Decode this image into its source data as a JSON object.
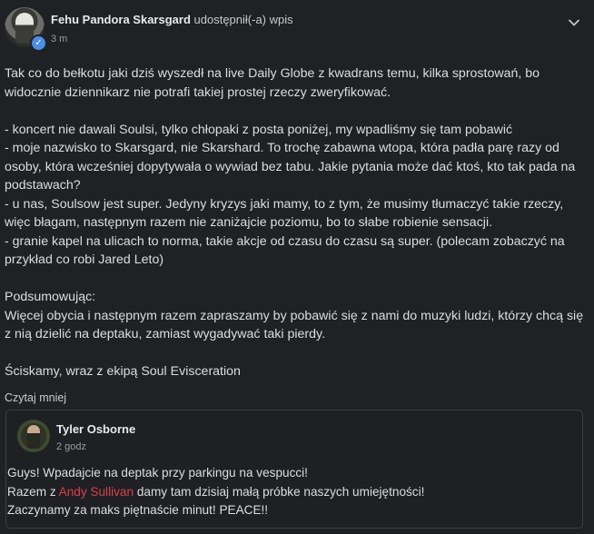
{
  "post": {
    "author": "Fehu Pandora Skarsgard",
    "shared_label": "udostępnił(-a) wpis",
    "time": "3 m",
    "paragraphs": [
      "Tak co do bełkotu jaki dziś wyszedł na live Daily Globe z kwadrans temu, kilka sprostowań, bo widocznie dziennikarz nie potrafi takiej prostej rzeczy zweryfikować.",
      "- koncert nie dawali Soulsi, tylko chłopaki z posta poniżej, my wpadliśmy się tam pobawić\n- moje nazwisko to Skarsgard, nie Skarshard. To trochę zabawna wtopa, która padła parę razy od osoby, która wcześniej dopytywała o wywiad bez tabu. Jakie pytania może dać ktoś, kto tak pada na podstawach?\n- u nas, Soulsow jest super. Jedyny kryzys jaki mamy, to z tym, że musimy tłumaczyć takie rzeczy, więc błagam, następnym razem nie zaniżajcie poziomu, bo to słabe robienie sensacji.\n- granie kapel na ulicach to norma, takie akcje od czasu do czasu są super. (polecam zobaczyć na przykład co robi Jared Leto)",
      "Podsumowując:\nWięcej obycia i następnym razem zapraszamy by pobawić się z nami do muzyki ludzi, którzy chcą się z nią dzielić na deptaku, zamiast wygadywać taki pierdy.",
      "Ściskamy, wraz z ekipą Soul Evisceration"
    ],
    "read_less": "Czytaj mniej"
  },
  "shared": {
    "author": "Tyler Osborne",
    "time": "2 godz",
    "line1": "Guys! Wpadajcie na deptak przy parkingu na vespucci!",
    "line2_before": "Razem z ",
    "line2_mention": "Andy Sullivan",
    "line2_after": " damy tam dzisiaj małą próbke naszych umiejętności!",
    "line3": "Zaczynamy za maks piętnaście minut! PEACE!!"
  },
  "colors": {
    "background": "#202124",
    "mention": "#d9414a",
    "verified": "#4a8fe7"
  },
  "icons": {
    "verified": "verified-badge-icon",
    "menu": "chevron-down-icon"
  }
}
